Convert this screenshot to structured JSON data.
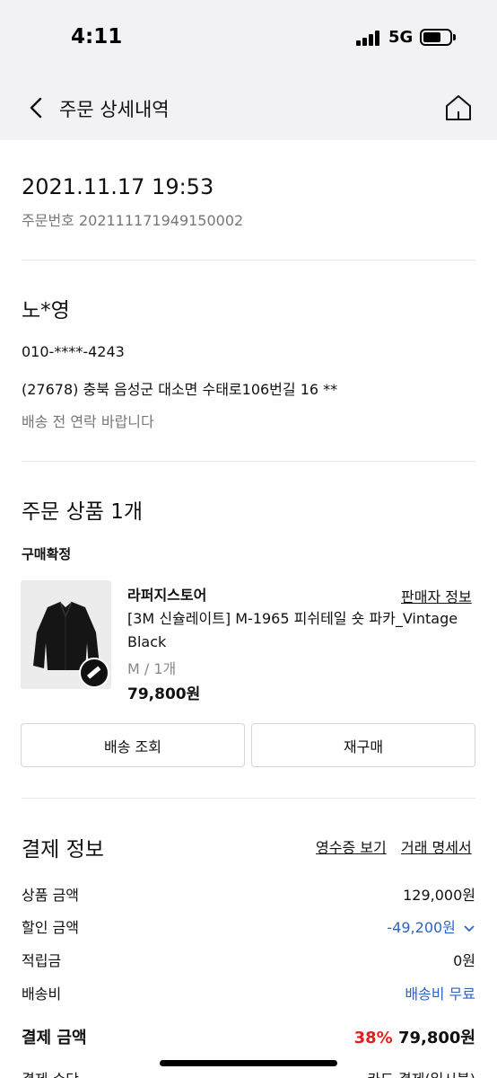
{
  "status_bar": {
    "time": "4:11",
    "network": "5G"
  },
  "nav": {
    "title": "주문 상세내역",
    "back_icon": "chevron-left-icon",
    "home_icon": "home-icon"
  },
  "order": {
    "datetime": "2021.11.17 19:53",
    "number": "주문번호 202111171949150002"
  },
  "recipient": {
    "name": "노*영",
    "phone": "010-****-4243",
    "address": "(27678) 충북 음성군 대소면 수태로106번길 16 **",
    "note": "배송 전 연락 바랍니다"
  },
  "items": {
    "title": "주문 상품 1개",
    "status": "구매확정",
    "store": "라퍼지스토어",
    "seller_info": "판매자 정보",
    "product_name": "[3M 신슐레이트] M-1965 피쉬테일 숏 파카_Vintage Black",
    "option": "M / 1개",
    "price": "79,800원",
    "track_button": "배송 조회",
    "reorder_button": "재구매"
  },
  "payment": {
    "title": "결제 정보",
    "receipt_link": "영수증 보기",
    "statement_link": "거래 명세서",
    "rows": [
      {
        "label": "상품 금액",
        "value": "129,000원"
      },
      {
        "label": "할인 금액",
        "value": "-49,200원"
      },
      {
        "label": "적립금",
        "value": "0원"
      },
      {
        "label": "배송비",
        "value": "배송비 무료"
      }
    ],
    "total_label": "결제 금액",
    "discount_rate": "38%",
    "total_value": "79,800원",
    "method_label": "결제 수단",
    "method_value": "카드 결제(일시불)"
  },
  "colors": {
    "accent_blue": "#2f63c8",
    "accent_red": "#e02020",
    "header_bg": "#f2f2f4"
  }
}
